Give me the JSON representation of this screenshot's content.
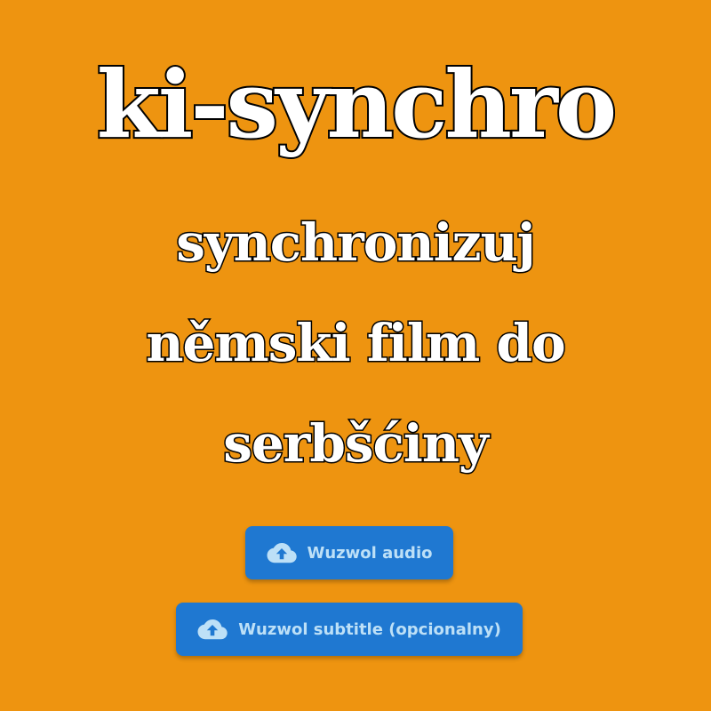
{
  "header": {
    "title": "ki-synchro",
    "subtitle_lines": [
      "synchronizuj",
      "němski film do",
      "serbšćiny"
    ]
  },
  "actions": {
    "upload_audio_label": "Wuzwol audio",
    "upload_subtitle_label": "Wuzwol subtitle (opcionalny)",
    "icon": "cloud-upload-icon"
  },
  "colors": {
    "background": "#EE9410",
    "button": "#1F78D1",
    "button_text": "#BDE0F7"
  }
}
